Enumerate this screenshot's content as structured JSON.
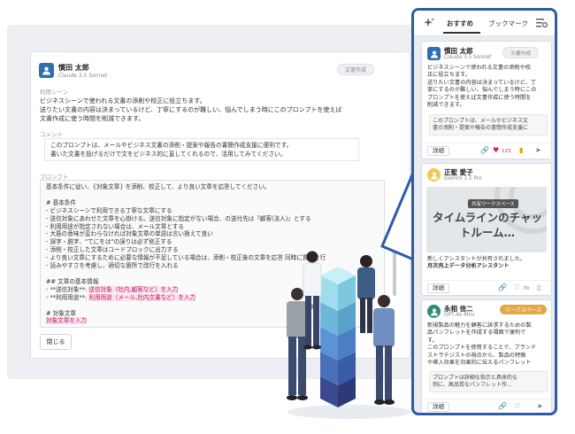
{
  "detail": {
    "author_name": "慣田 太郎",
    "model": "Claude 3.5 Sonnet",
    "tag": "文書作成",
    "usage_label": "利用シーン",
    "usage_lines": [
      "ビジネスシーンで使われる文書の添削や校正に役立ちます。",
      "送りたい文書の内容は決まっているけど、丁寧にするのが難しい、悩んでしまう時にこのプロンプトを使えば",
      "文書作成に使う時間を削減できます。"
    ],
    "comment_label": "コメント",
    "comment_lines": [
      "このプロンプトは、メールやビジネス文書の添削・提案や報告の書簡作成支援に便利です。",
      "書いた文書を投げるだけで文をビジネス的に直してくれるので、活用してみてください。"
    ],
    "prompt_label": "プロンプト",
    "prompt_lines": [
      "基本条件に従い、{対象文章} を添削、校正して、より良い文章を応答してください。",
      "",
      "# 基本条件",
      "- ビジネスシーンで利用できる丁寧な文章にする",
      "- 送信対象にあわせた文章を心掛ける。送信対象に指定がない場合、の送付先は『顧客(法人)』とする",
      "- 利用用途が指定されない場合は、メール文章とする",
      "- 大筋の意味が変わらなければ対象文章の単語は言い換えて良い",
      "- 誤字・脱字、\"てにをは\"の誤りは必ず修正する",
      "- 添削・校正した文章はコードブロックに出力する",
      "- より良い文章にするために必要な情報が不足している場合は、添削・校正後の文章を応答 同時に質問を行",
      "- 読みやすさを考慮し、適切な箇所で改行を入れる",
      "",
      "## 文章の基本情報",
      "- **送信対象**: ",
      "- **利用用途**: ",
      "",
      "# 対象文章",
      ""
    ],
    "send_target_value": "送信対象（社内,顧客など）を入力",
    "usage_value": "利用用途（メール,社内文書など）を入力",
    "target_text_value": "対象文章を入力",
    "close_label": "閉じる"
  },
  "panel": {
    "tabs": [
      "おすすめ",
      "ブックマーク"
    ],
    "active_tab": "おすすめ",
    "cards": [
      {
        "author": "慣田 太郎",
        "model": "Claude 3.5 Sonnet",
        "tag": "文書作成",
        "desc_lines": [
          "ビジネスシーンで使われる文書の添削や校",
          "正に役立ちます。",
          "送りたい文書の内容は決まっているけど、丁",
          "寧にするのが難しい、悩んでしまう時にこの",
          "プロンプトを使えば文書作成に使う時間を",
          "削減できます。"
        ],
        "quote_lines": [
          "このプロンプトは、メールやビジネス文",
          "書の添削・提案や報告の書簡作成支援に"
        ],
        "detail_label": "詳細",
        "likes": "123"
      },
      {
        "author": "正聖 愛子",
        "model": "Gemini 1.5 Pro",
        "thumb_badge": "共有ワークスペース",
        "thumb_title": "タイムラインのチャットルーム…",
        "desc_lines": [
          "新しくアシスタントが共有されました。",
          "月次売上データ分析アシスタント"
        ],
        "detail_label": "詳細",
        "likes": "70"
      },
      {
        "author": "永相 信二",
        "model": "GPT-4o-Mini",
        "tag": "ワークスペース",
        "desc_lines": [
          "新規製品の魅力を顧客に訴求するための製",
          "品パンフレットを作成する場面で便利で",
          "す。",
          "このプロンプトを使用することで、ブランド",
          "ストラテジストの視点から、製品の特徴",
          "や導入効果を効果的に伝えるパンフレット"
        ],
        "quote_lines": [
          "プロンプトは詳細な指示と具体的な",
          "例に、高品質なパンフレット作..."
        ],
        "detail_label": "詳細"
      }
    ]
  },
  "colors": {
    "brand_blue": "#2d5ba5",
    "accent_pink": "#d81b60",
    "badge_orange": "#e0a84a"
  }
}
